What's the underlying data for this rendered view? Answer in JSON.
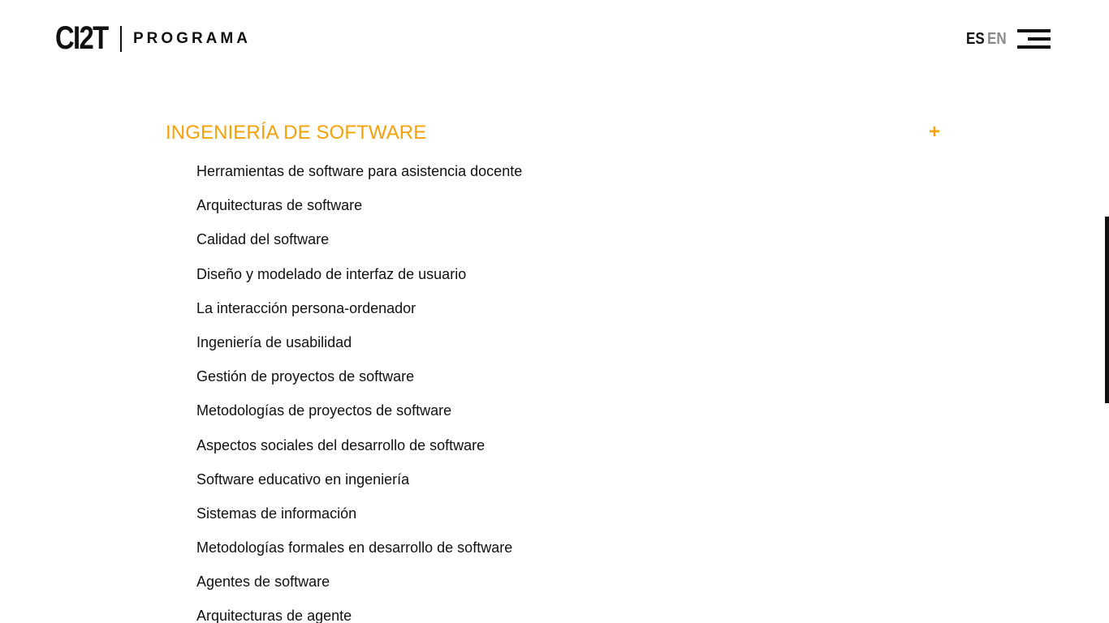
{
  "header": {
    "logo": "CI2T",
    "section": "PROGRAMA",
    "languages": [
      "ES",
      "EN"
    ],
    "active_language": "ES"
  },
  "accordion": {
    "title": "INGENIERÍA DE SOFTWARE",
    "toggle": "+",
    "accent_color": "#f5a20a",
    "items": [
      "Herramientas de software para asistencia docente",
      "Arquitecturas de software",
      "Calidad del software",
      "Diseño y modelado de interfaz de usuario",
      "La interacción persona-ordenador",
      "Ingeniería de usabilidad",
      "Gestión de proyectos de software",
      "Metodologías de proyectos de software",
      "Aspectos sociales del desarrollo de software",
      "Software educativo en ingeniería",
      "Sistemas de información",
      "Metodologías formales en desarrollo de software",
      "Agentes de software",
      "Arquitecturas de agente"
    ]
  },
  "icons": {
    "menu": "hamburger-menu-icon"
  }
}
